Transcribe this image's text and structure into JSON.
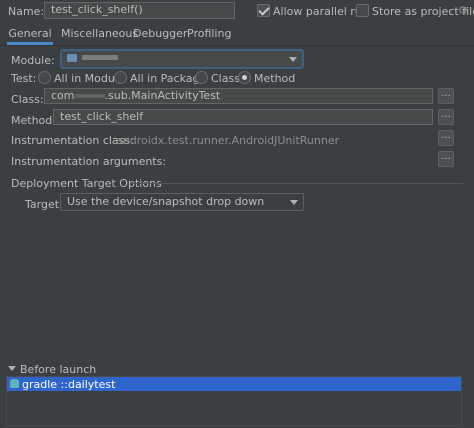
{
  "header": {
    "name_label": "Name:",
    "name_value": "test_click_shelf()",
    "allow_parallel_label": "Allow parallel run",
    "store_project_label": "Store as project file"
  },
  "tabs": [
    {
      "label": "General",
      "active": true
    },
    {
      "label": "Miscellaneous",
      "active": false
    },
    {
      "label": "Debugger",
      "active": false
    },
    {
      "label": "Profiling",
      "active": false
    }
  ],
  "general": {
    "module_label": "Module:",
    "test_label": "Test:",
    "test_options": [
      "All in Module",
      "All in Package",
      "Class",
      "Method"
    ],
    "test_selected": "Method",
    "class_label": "Class:",
    "class_value_prefix": "com",
    "class_value_suffix": ".sub.MainActivityTest",
    "method_label": "Method:",
    "method_value": "test_click_shelf",
    "instr_class_label": "Instrumentation class:",
    "instr_class_value": "androidx.test.runner.AndroidJUnitRunner",
    "instr_args_label": "Instrumentation arguments:",
    "browse_label": "..."
  },
  "deployment": {
    "section_label": "Deployment Target Options",
    "target_label": "Target:",
    "target_value": "Use the device/snapshot drop down"
  },
  "before_launch": {
    "section_label": "Before launch",
    "items": [
      {
        "label": "gradle ::dailytest",
        "selected": true
      }
    ]
  },
  "colors": {
    "background": "#3c3f41",
    "accent": "#4a88c7",
    "selection": "#2f65ca",
    "field_bg": "#45494a"
  }
}
